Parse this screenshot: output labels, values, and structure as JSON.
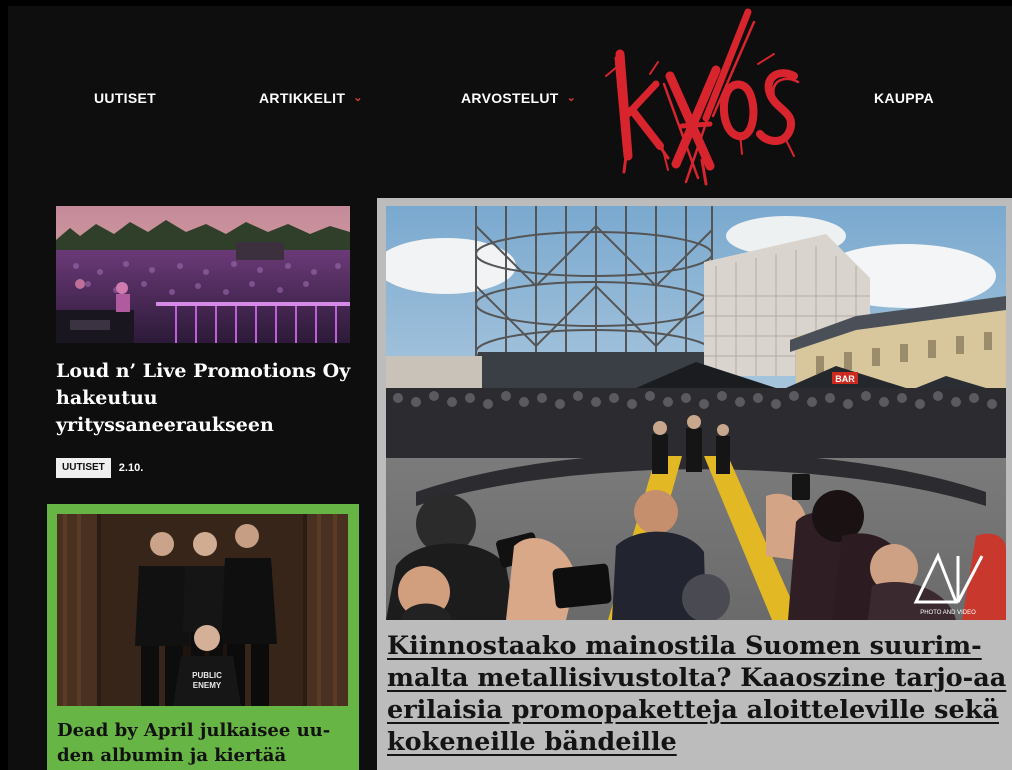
{
  "nav": {
    "items": [
      {
        "label": "UUTISET",
        "has_dropdown": false
      },
      {
        "label": "ARTIKKELIT",
        "has_dropdown": true
      },
      {
        "label": "ARVOSTELUT",
        "has_dropdown": true
      },
      {
        "label": "KAUPPA",
        "has_dropdown": false
      }
    ],
    "logo_text": "kaaos"
  },
  "articles": [
    {
      "title": "Loud n’ Live Promotions Oy hakeutuu yrityssaneeraukseen",
      "category": "UUTISET",
      "date": "2.10.",
      "image": "concert-crowd-photo"
    },
    {
      "title": "Dead by April julkaisee uu-den albumin ja kiertää",
      "image": "band-photo",
      "shirt_text": "PUBLIC ENEMY",
      "accent": "#67b544"
    }
  ],
  "feature": {
    "title": "Kiinnostaako mainostila Suomen suurim-malta metallisivustolta? Kaaoszine tarjo-aa erilaisia promopaketteja aloitteleville sekä kokeneille bändeille",
    "image": "festival-moshpit-photo",
    "stage_sign": "BAR",
    "watermark": "PHOTO AND VIDEO"
  },
  "colors": {
    "background": "#0e0e0e",
    "brand_red": "#d8252d",
    "card_green": "#67b544",
    "feature_bg": "#bcbcbc"
  }
}
